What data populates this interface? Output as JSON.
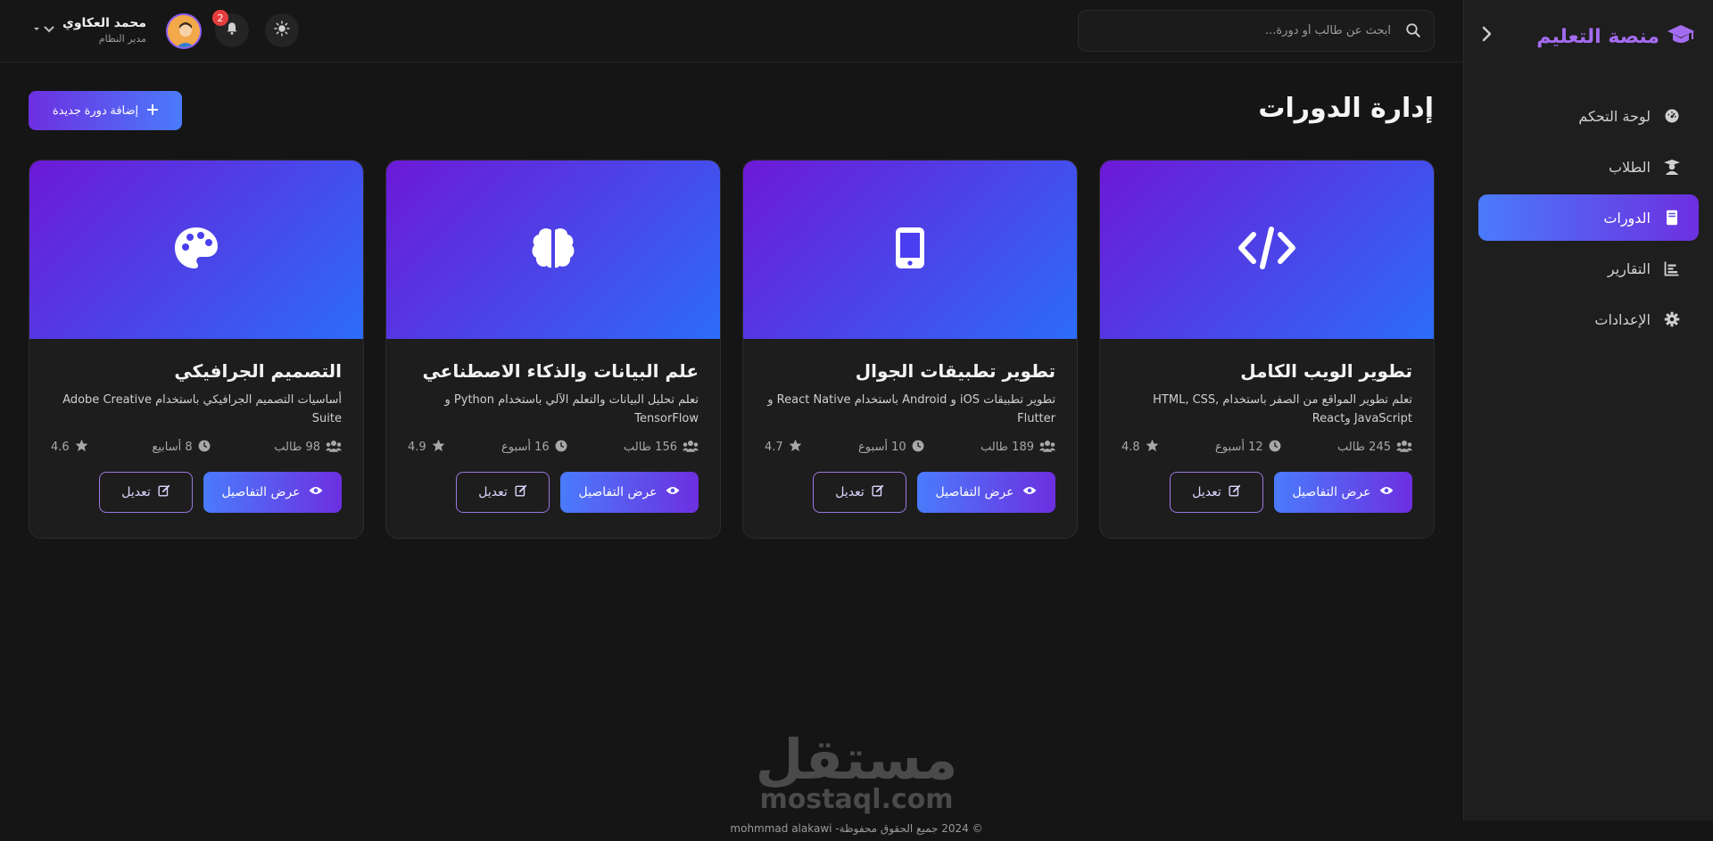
{
  "sidebar": {
    "brand": "منصة التعليم",
    "items": [
      {
        "label": "لوحة التحكم",
        "icon": "dashboard-icon"
      },
      {
        "label": "الطلاب",
        "icon": "graduate-icon"
      },
      {
        "label": "الدورات",
        "icon": "book-icon",
        "active": true
      },
      {
        "label": "التقارير",
        "icon": "chart-icon"
      },
      {
        "label": "الإعدادات",
        "icon": "gear-icon"
      }
    ]
  },
  "header": {
    "search_placeholder": "ابحث عن طالب أو دورة...",
    "user_name": "محمد العكاوي",
    "user_role": "مدير النظام",
    "notification_count": "2"
  },
  "main": {
    "title": "إدارة الدورات",
    "add_label": "إضافة دورة جديدة",
    "view_label": "عرض التفاصيل",
    "edit_label": "تعديل",
    "courses": [
      {
        "title": "تطوير الويب الكامل",
        "desc": "تعلم تطوير المواقع من الصفر باستخدام HTML, CSS, JavaScript وReact",
        "students": "245 طالب",
        "duration": "12 أسبوع",
        "rating": "4.8",
        "icon": "code-icon"
      },
      {
        "title": "تطوير تطبيقات الجوال",
        "desc": "تطوير تطبيقات iOS و Android باستخدام React Native و Flutter",
        "students": "189 طالب",
        "duration": "10 أسبوع",
        "rating": "4.7",
        "icon": "mobile-icon"
      },
      {
        "title": "علم البيانات والذكاء الاصطناعي",
        "desc": "تعلم تحليل البيانات والتعلم الآلي باستخدام Python و TensorFlow",
        "students": "156 طالب",
        "duration": "16 أسبوع",
        "rating": "4.9",
        "icon": "brain-icon"
      },
      {
        "title": "التصميم الجرافيكي",
        "desc": "أساسيات التصميم الجرافيكي باستخدام Adobe Creative Suite",
        "students": "98 طالب",
        "duration": "8 أسابيع",
        "rating": "4.6",
        "icon": "palette-icon"
      }
    ]
  },
  "footer": {
    "copyright": "© 2024 جميع الحقوق محفوظة- mohmmad alakawi",
    "watermark_ar": "مستقل",
    "watermark_en": "mostaql.com"
  },
  "colors": {
    "accent_purple": "#6d2fe0",
    "accent_blue": "#4a7bfb",
    "brand_text": "#a46cf0",
    "background": "#151515"
  }
}
